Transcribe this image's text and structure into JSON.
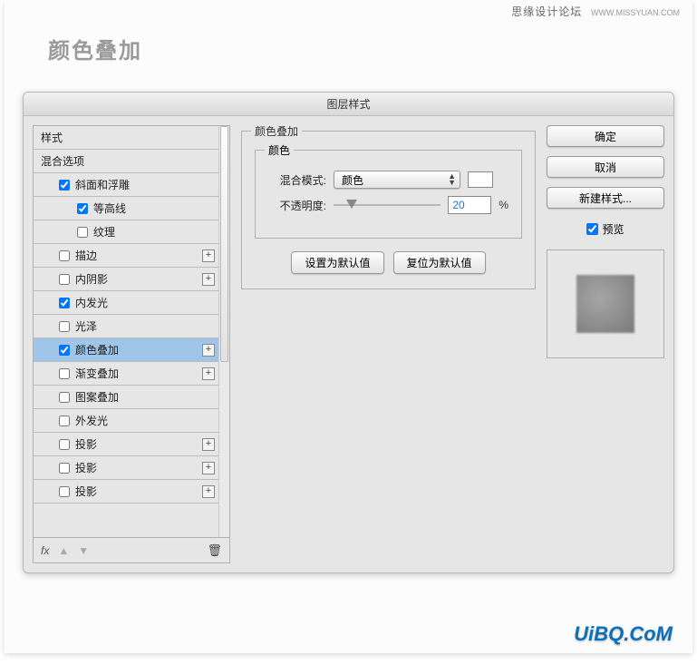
{
  "watermark": {
    "main": "思缘设计论坛",
    "sub": "WWW.MISSYUAN.COM",
    "bottom": "UiBQ.CoM"
  },
  "header": {
    "title": "颜色叠加"
  },
  "dialog": {
    "title": "图层样式",
    "styles": {
      "header": "样式",
      "blend": "混合选项",
      "items": [
        {
          "label": "斜面和浮雕",
          "checked": true,
          "plus": false,
          "sub": true
        },
        {
          "label": "等高线",
          "checked": true,
          "plus": false,
          "sub2": true
        },
        {
          "label": "纹理",
          "checked": false,
          "plus": false,
          "sub2": true
        },
        {
          "label": "描边",
          "checked": false,
          "plus": true,
          "sub": true
        },
        {
          "label": "内阴影",
          "checked": false,
          "plus": true,
          "sub": true
        },
        {
          "label": "内发光",
          "checked": true,
          "plus": false,
          "sub": true
        },
        {
          "label": "光泽",
          "checked": false,
          "plus": false,
          "sub": true
        },
        {
          "label": "颜色叠加",
          "checked": true,
          "plus": true,
          "sub": true,
          "selected": true
        },
        {
          "label": "渐变叠加",
          "checked": false,
          "plus": true,
          "sub": true
        },
        {
          "label": "图案叠加",
          "checked": false,
          "plus": false,
          "sub": true
        },
        {
          "label": "外发光",
          "checked": false,
          "plus": false,
          "sub": true
        },
        {
          "label": "投影",
          "checked": false,
          "plus": true,
          "sub": true
        },
        {
          "label": "投影",
          "checked": false,
          "plus": true,
          "sub": true
        },
        {
          "label": "投影",
          "checked": false,
          "plus": true,
          "sub": true
        }
      ],
      "footer_fx": "fx"
    },
    "panel": {
      "group_title": "颜色叠加",
      "subgroup_title": "颜色",
      "blend_label": "混合模式:",
      "blend_value": "颜色",
      "opacity_label": "不透明度:",
      "opacity_value": "20",
      "opacity_unit": "%",
      "btn_default": "设置为默认值",
      "btn_reset": "复位为默认值"
    },
    "right": {
      "ok": "确定",
      "cancel": "取消",
      "new_style": "新建样式...",
      "preview": "预览"
    }
  }
}
